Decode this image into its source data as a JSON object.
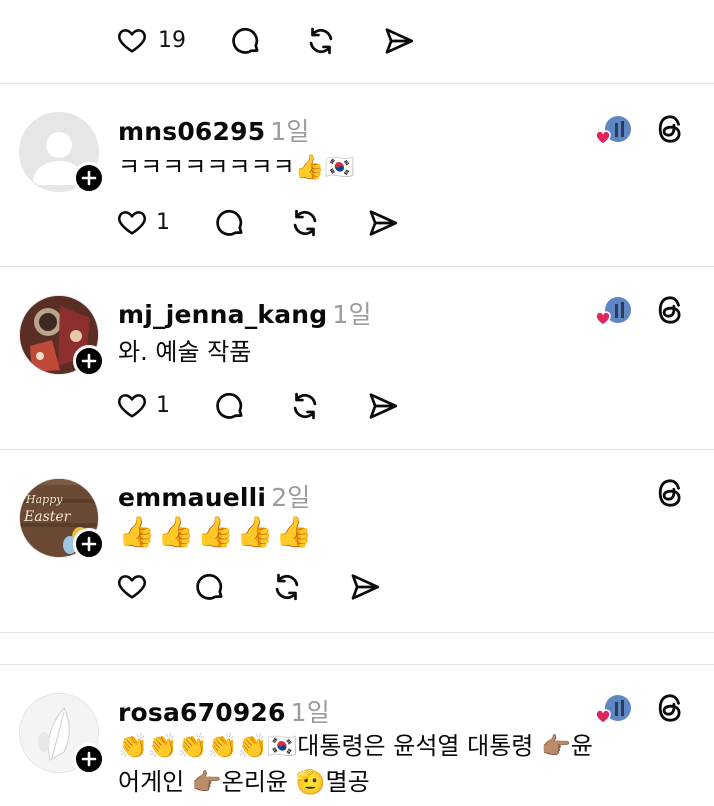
{
  "colors": {
    "text": "#0a0a0a",
    "muted": "#9b9b9b",
    "divider": "#e2e2e2",
    "heart": "#e0245e",
    "badge": "#000000"
  },
  "top_post": {
    "like_count": "19"
  },
  "posts": [
    {
      "username": "mns06295",
      "time": "1일",
      "text": "ㅋㅋㅋㅋㅋㅋㅋㅋ👍🇰🇷",
      "like_count": "1",
      "liked_by_author": true,
      "avatar": "default-avatar"
    },
    {
      "username": "mj_jenna_kang",
      "time": "1일",
      "text": "와. 예술 작품",
      "like_count": "1",
      "liked_by_author": true,
      "avatar": "patterned-avatar"
    },
    {
      "username": "emmauelli",
      "time": "2일",
      "text": "👍👍👍👍👍",
      "like_count": "",
      "liked_by_author": false,
      "avatar": "easter-avatar",
      "avatar_text": "Happy Easter"
    },
    {
      "username": "rosa670926",
      "time": "1일",
      "text_line1": "👏👏👏👏👏🇰🇷대통령은 윤석열 대통령 👉🏽윤",
      "text_line2": "어게인 👉🏽온리윤 🫡멸공",
      "liked_by_author": true,
      "avatar": "white-feather-avatar"
    }
  ],
  "icons": {
    "like": "heart-outline-icon",
    "reply": "speech-bubble-icon",
    "repost": "repost-arrows-icon",
    "share": "send-arrow-icon",
    "follow": "plus-icon",
    "threads": "threads-logo-icon",
    "liked_by_author": "heart-with-avatar-icon"
  }
}
